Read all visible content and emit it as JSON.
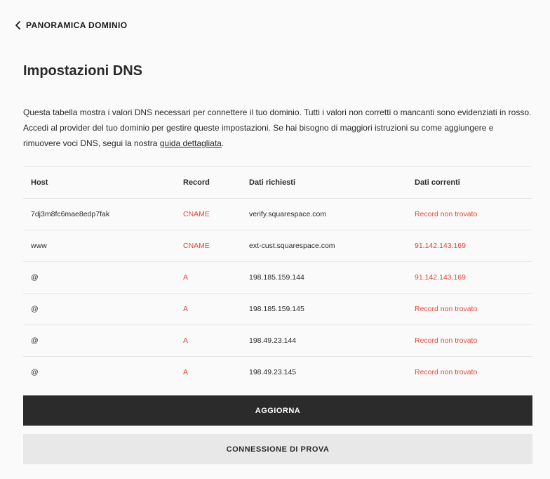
{
  "nav": {
    "back_label": "PANORAMICA DOMINIO"
  },
  "page": {
    "title": "Impostazioni DNS",
    "description": "Questa tabella mostra i valori DNS necessari per connettere il tuo dominio. Tutti i valori non corretti o mancanti sono evidenziati in rosso. Accedi al provider del tuo dominio per gestire queste impostazioni. Se hai bisogno di maggiori istruzioni su come aggiungere e rimuovere voci DNS, segui la nostra ",
    "description_link": "guida dettagliata",
    "description_end": "."
  },
  "table": {
    "headers": {
      "host": "Host",
      "record": "Record",
      "required": "Dati richiesti",
      "current": "Dati correnti"
    },
    "rows": [
      {
        "host": "7dj3m8fc6mae8edp7fak",
        "record": "CNAME",
        "required": "verify.squarespace.com",
        "current": "Record non trovato"
      },
      {
        "host": "www",
        "record": "CNAME",
        "required": "ext-cust.squarespace.com",
        "current": "91.142.143.169"
      },
      {
        "host": "@",
        "record": "A",
        "required": "198.185.159.144",
        "current": "91.142.143.169"
      },
      {
        "host": "@",
        "record": "A",
        "required": "198.185.159.145",
        "current": "Record non trovato"
      },
      {
        "host": "@",
        "record": "A",
        "required": "198.49.23.144",
        "current": "Record non trovato"
      },
      {
        "host": "@",
        "record": "A",
        "required": "198.49.23.145",
        "current": "Record non trovato"
      }
    ]
  },
  "actions": {
    "refresh_label": "AGGIORNA",
    "test_label": "CONNESSIONE DI PROVA"
  },
  "colors": {
    "error": "#e0473c",
    "primary_button": "#2b2b2b",
    "secondary_button": "#e8e8e8"
  },
  "icons": {
    "back": "chevron-left-icon"
  }
}
